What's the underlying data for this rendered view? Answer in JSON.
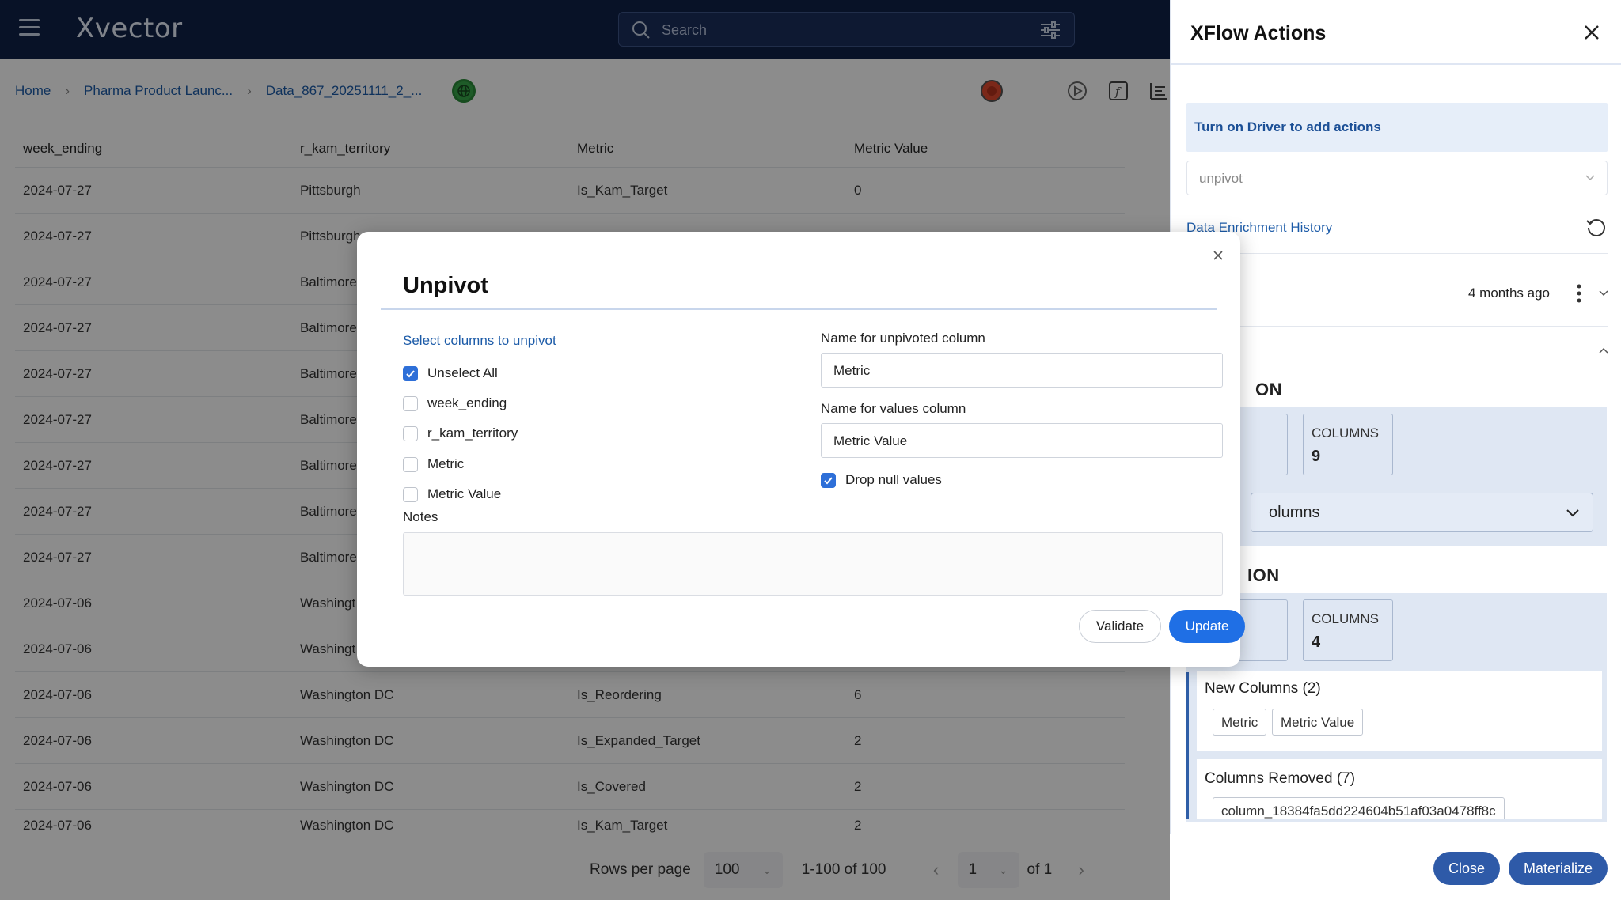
{
  "app": {
    "logo": "Xvector",
    "search_placeholder": "Search"
  },
  "breadcrumb": [
    "Home",
    "Pharma Product Launc...",
    "Data_867_20251111_2_..."
  ],
  "table": {
    "headers": [
      "week_ending",
      "r_kam_territory",
      "Metric",
      "Metric Value"
    ],
    "rows": [
      [
        "2024-07-27",
        "Pittsburgh",
        "Is_Kam_Target",
        "0"
      ],
      [
        "2024-07-27",
        "Pittsburgh",
        "",
        ""
      ],
      [
        "2024-07-27",
        "Baltimore",
        "",
        ""
      ],
      [
        "2024-07-27",
        "Baltimore",
        "",
        ""
      ],
      [
        "2024-07-27",
        "Baltimore",
        "",
        ""
      ],
      [
        "2024-07-27",
        "Baltimore",
        "",
        ""
      ],
      [
        "2024-07-27",
        "Baltimore",
        "",
        ""
      ],
      [
        "2024-07-27",
        "Baltimore",
        "",
        ""
      ],
      [
        "2024-07-27",
        "Baltimore",
        "",
        ""
      ],
      [
        "2024-07-06",
        "Washingt",
        "",
        ""
      ],
      [
        "2024-07-06",
        "Washingt",
        "",
        ""
      ],
      [
        "2024-07-06",
        "Washington DC",
        "Is_Reordering",
        "6"
      ],
      [
        "2024-07-06",
        "Washington DC",
        "Is_Expanded_Target",
        "2"
      ],
      [
        "2024-07-06",
        "Washington DC",
        "Is_Covered",
        "2"
      ],
      [
        "2024-07-06",
        "Washington DC",
        "Is_Kam_Target",
        "2"
      ]
    ]
  },
  "pager": {
    "rows_label": "Rows per page",
    "rows_value": "100",
    "range": "1-100 of 100",
    "page": "1",
    "of": "of 1"
  },
  "panel": {
    "title": "XFlow Actions",
    "driver_notice": "Turn on Driver to add actions",
    "action_select": "unpivot",
    "history_link": "Data Enrichment History",
    "time_ago": "4 months ago",
    "section1_label": "ON",
    "section1_cols_key": "COLUMNS",
    "section1_cols_val": "9",
    "columns_select": "olumns",
    "section2_label": "ION",
    "section2_cols_key": "COLUMNS",
    "section2_cols_val": "4",
    "new_columns_title": "New Columns (2)",
    "new_columns": [
      "Metric",
      "Metric Value"
    ],
    "removed_title": "Columns Removed (7)",
    "removed_first": "column_18384fa5dd224604b51af03a0478ff8c",
    "close_label": "Close",
    "materialize_label": "Materialize"
  },
  "modal": {
    "title": "Unpivot",
    "select_label": "Select columns to unpivot",
    "options": [
      {
        "label": "Unselect All",
        "checked": true
      },
      {
        "label": "week_ending",
        "checked": false
      },
      {
        "label": "r_kam_territory",
        "checked": false
      },
      {
        "label": "Metric",
        "checked": false
      },
      {
        "label": "Metric Value",
        "checked": false
      }
    ],
    "unpivoted_label": "Name for unpivoted column",
    "unpivoted_value": "Metric",
    "values_label": "Name for values column",
    "values_value": "Metric Value",
    "drop_null_label": "Drop null values",
    "drop_null_checked": true,
    "notes_label": "Notes",
    "notes_value": "",
    "validate_label": "Validate",
    "update_label": "Update"
  },
  "colors": {
    "topbar": "#0f2147",
    "accent": "#2e5aa8",
    "primary_button": "#1f6fe5",
    "link": "#1c5ba8"
  }
}
